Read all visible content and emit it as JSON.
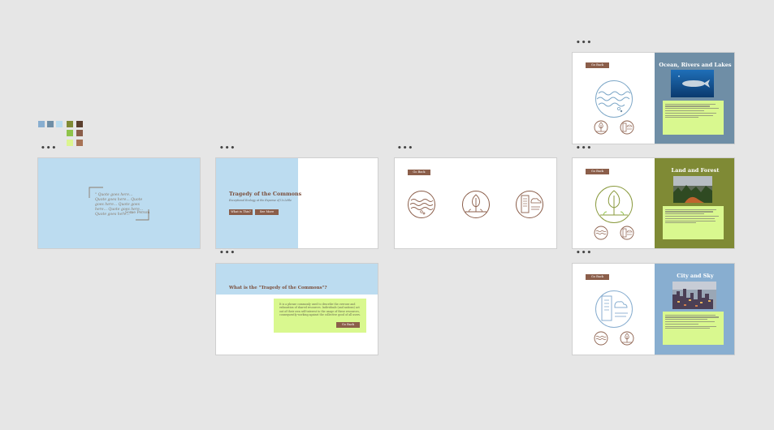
{
  "palette": {
    "colors": [
      "#88aed0",
      "#6f8ea6",
      "#b9dcef",
      "#7f8a35",
      "#5b3f2e",
      "#8fc34a",
      "#8b5e4a",
      "#dcf58f",
      "#a87356"
    ]
  },
  "frames": {
    "quote": {
      "dots": "•••",
      "text": "\" Quote goes here... Quote goes here... Quote goes here... Quote goes here... Quote goes here... Quote goes here... \"",
      "author": "- Some Person"
    },
    "title_slide": {
      "dots": "•••",
      "title": "Tragedy of the Commons",
      "subtitle": "Exceptional Ecology at the Expense of Us Little",
      "btn_what": "What is This?",
      "btn_see": "See More"
    },
    "what_slide": {
      "dots": "•••",
      "title": "What is the \"Tragedy of the Commons\"?",
      "body": "It is a phrase commonly used to describe the overuse and exhaustion of shared resources. Individuals (and nations) act out of their own self-interest to the usage of these resources, consequently working against the collective good of all users.",
      "go_back": "Go Back"
    },
    "icons_slide": {
      "dots": "•••",
      "go_back": "Go Back"
    },
    "ocean": {
      "dots": "•••",
      "go_back": "Go Back",
      "title": "Ocean, Rivers and Lakes"
    },
    "land": {
      "dots": "•••",
      "go_back": "Go Back",
      "title": "Land and Forest"
    },
    "city": {
      "dots": "•••",
      "go_back": "Go Back",
      "title": "City and Sky"
    }
  },
  "colors": {
    "canvas": "#e6e6e6",
    "light_blue": "#bcdcf0",
    "brown": "#8b5e4a",
    "ocean_panel": "#6f8ea6",
    "land_panel": "#7f8a35",
    "city_panel": "#88aed0",
    "green_box": "#d9f88f"
  }
}
